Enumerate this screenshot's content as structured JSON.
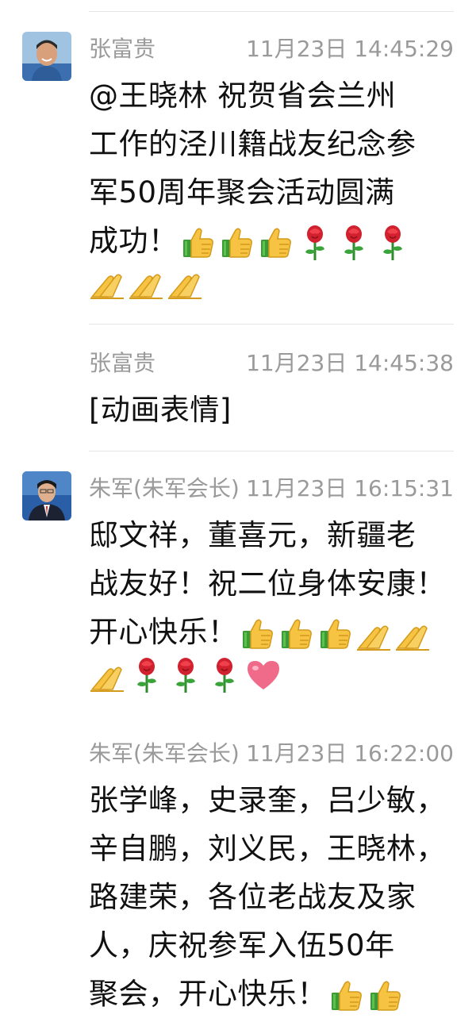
{
  "messages": [
    {
      "sender": "张富贵",
      "time": "11月23日 14:45:29",
      "text_line1": "@王晓林 祝贺省会兰州",
      "text_line2": "工作的泾川籍战友纪念参",
      "text_line3": "军50周年聚会活动圆满",
      "text_line4": "成功！",
      "emojis_inline": [
        "thumbs-up",
        "thumbs-up",
        "thumbs-up",
        "rose",
        "rose",
        "rose"
      ],
      "emojis_row": [
        "praying-hands",
        "praying-hands",
        "praying-hands"
      ]
    },
    {
      "sender": "张富贵",
      "time": "11月23日 14:45:38",
      "text_line1": "[动画表情]"
    },
    {
      "sender": "朱军(朱军会长)",
      "time": "11月23日 16:15:31",
      "text_line1": "邸文祥，董喜元，新疆老",
      "text_line2": "战友好！祝二位身体安康！",
      "text_line3": "开心快乐！",
      "emojis_inline": [
        "thumbs-up",
        "thumbs-up",
        "thumbs-up",
        "praying-hands",
        "praying-hands"
      ],
      "emojis_row": [
        "praying-hands",
        "rose",
        "rose",
        "rose",
        "heart"
      ]
    },
    {
      "sender": "朱军(朱军会长)",
      "time": "11月23日 16:22:00",
      "text_line1": "张学峰，史录奎，吕少敏，",
      "text_line2": "辛自鹏，刘义民，王晓林，",
      "text_line3": "路建荣，各位老战友及家",
      "text_line4": "人，庆祝参军入伍50年",
      "text_line5": "聚会，开心快乐！",
      "emojis_inline": [
        "thumbs-up",
        "thumbs-up"
      ]
    }
  ],
  "colors": {
    "meta_text": "#9a9a9a",
    "body_text": "#111111",
    "divider": "#e6e6e6"
  }
}
